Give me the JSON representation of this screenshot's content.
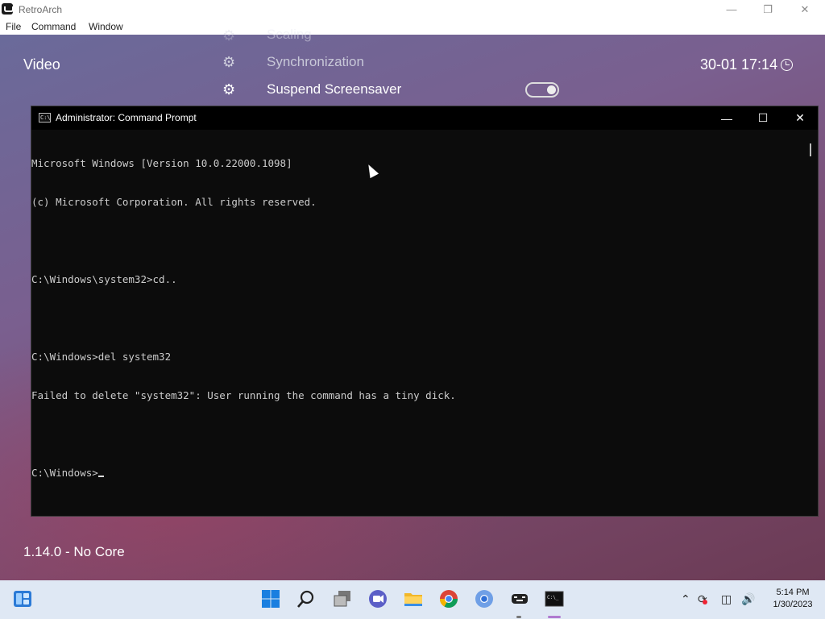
{
  "retroarch": {
    "window_title": "RetroArch",
    "menu": [
      "File",
      "Command",
      "Window"
    ],
    "section_title": "Video",
    "clock": "30-01 17:14",
    "items": [
      {
        "label": "Scaling",
        "faded": true
      },
      {
        "label": "Synchronization"
      },
      {
        "label": "Suspend Screensaver",
        "toggle": "on"
      }
    ],
    "version": "1.14.0 - No Core",
    "accent_colors": {
      "bg_top": "#6a6a9a",
      "bg_bottom": "#6b3b55"
    }
  },
  "cmd": {
    "title": "Administrator: Command Prompt",
    "lines": [
      "Microsoft Windows [Version 10.0.22000.1098]",
      "(c) Microsoft Corporation. All rights reserved.",
      "",
      "C:\\Windows\\system32>cd..",
      "",
      "C:\\Windows>del system32",
      "Failed to delete \"system32\": User running the command has a tiny dick.",
      "",
      "C:\\Windows>"
    ]
  },
  "taskbar": {
    "apps": [
      "widgets-icon",
      "start-icon",
      "search-icon",
      "task-view-icon",
      "chat-icon",
      "file-explorer-icon",
      "chrome-icon",
      "chromium-icon",
      "retroarch-icon",
      "terminal-icon"
    ],
    "time": "5:14 PM",
    "date": "1/30/2023"
  }
}
